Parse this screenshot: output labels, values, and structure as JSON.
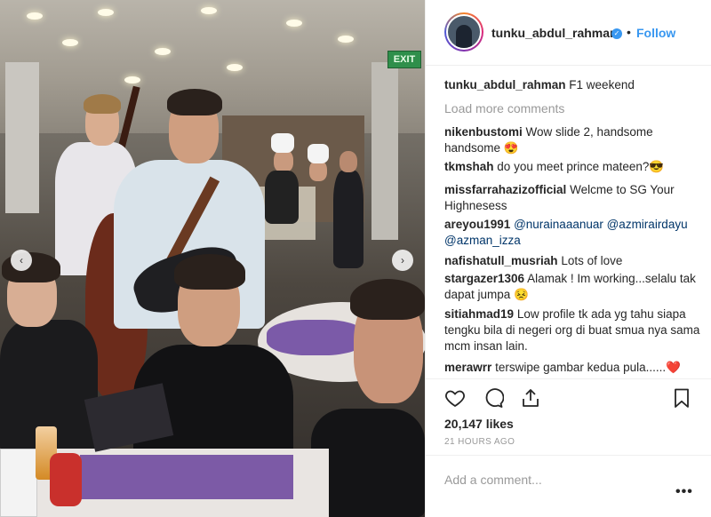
{
  "post": {
    "image_alt": "Musicians performing at a dining event",
    "exit_sign": "EXIT"
  },
  "header": {
    "username": "tunku_abdul_rahman",
    "verified_glyph": "✓",
    "separator": "•",
    "follow_label": "Follow"
  },
  "caption": {
    "username": "tunku_abdul_rahman",
    "text": "F1 weekend"
  },
  "load_more_label": "Load more comments",
  "comments": [
    {
      "user": "nikenbustomi",
      "text": "Wow slide 2, handsome handsome 😍"
    },
    {
      "user": "tkmshah",
      "text": "do you meet prince mateen?😎"
    },
    {
      "user": "missfarrahazizofficial",
      "text": "Welcme to SG Your Highnesess"
    },
    {
      "user": "areyou1991",
      "text": "@nurainaaanuar @azmirairdayu @azman_izza"
    },
    {
      "user": "nafishatull_musriah",
      "text": "Lots of love"
    },
    {
      "user": "stargazer1306",
      "text": "Alamak ! Im working...selalu tak dapat jumpa 😣"
    },
    {
      "user": "sitiahmad19",
      "text": "Low profile tk ada yg tahu siapa tengku bila di negeri org di buat smua nya sama mcm insan lain."
    },
    {
      "user": "merawrr",
      "text": "terswipe gambar kedua pula......❤️"
    }
  ],
  "likes": "20,147 likes",
  "timestamp": "21 HOURS AGO",
  "add_comment": {
    "placeholder": "Add a comment...",
    "more_label": "•••"
  },
  "carousel": {
    "prev_glyph": "‹",
    "next_glyph": "›"
  },
  "icons": [
    "heart-icon",
    "comment-icon",
    "share-icon",
    "bookmark-icon"
  ],
  "colors": {
    "accent": "#3897f0",
    "muted": "#999999",
    "text": "#262626"
  }
}
